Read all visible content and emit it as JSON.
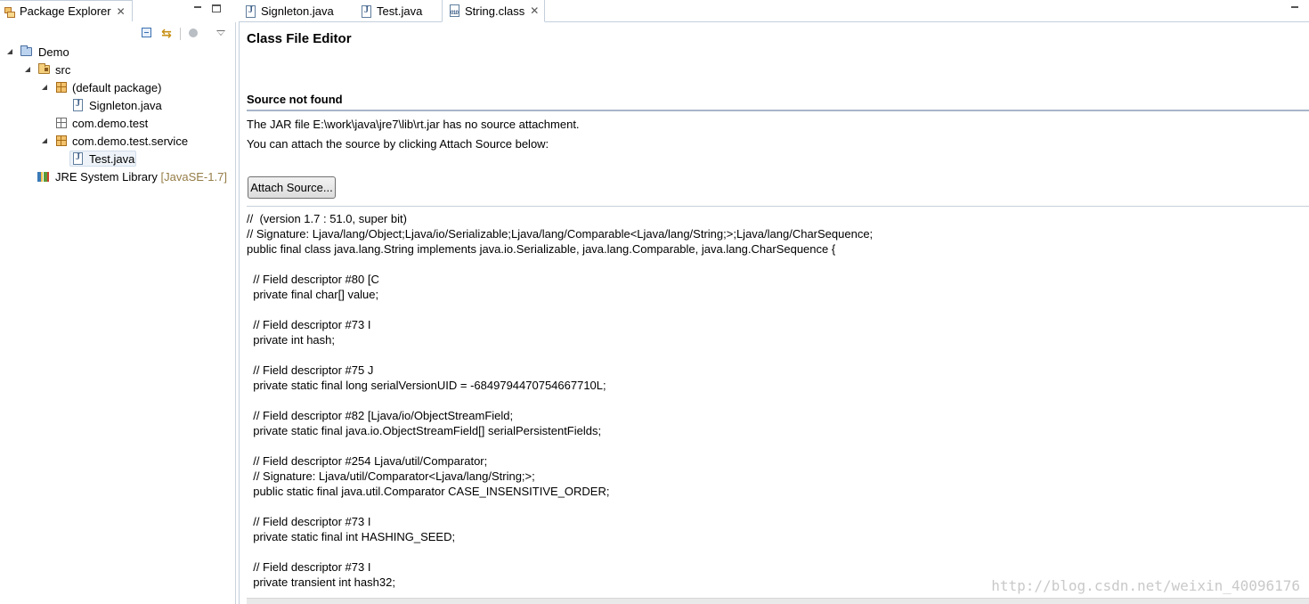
{
  "package_explorer": {
    "tab_label": "Package Explorer",
    "tree": [
      {
        "label": "Demo",
        "icon": "project-icon",
        "expanded": true
      },
      {
        "label": "src",
        "icon": "source-folder-icon",
        "expanded": true
      },
      {
        "label": "(default package)",
        "icon": "package-icon",
        "expanded": true
      },
      {
        "label": "Signleton.java",
        "icon": "java-file-icon",
        "expanded": false
      },
      {
        "label": "com.demo.test",
        "icon": "empty-package-icon"
      },
      {
        "label": "com.demo.test.service",
        "icon": "package-icon",
        "expanded": true
      },
      {
        "label": "Test.java",
        "icon": "java-file-icon",
        "expanded": false,
        "selected": true
      },
      {
        "label": "JRE System Library",
        "suffix": "[JavaSE-1.7]",
        "icon": "library-icon",
        "expanded": false
      }
    ]
  },
  "editor": {
    "tabs": [
      {
        "label": "Signleton.java",
        "icon": "java-file-icon",
        "active": false
      },
      {
        "label": "Test.java",
        "icon": "java-file-icon",
        "active": false
      },
      {
        "label": "String.class",
        "icon": "class-file-icon",
        "active": true
      }
    ],
    "title": "Class File Editor",
    "section_title": "Source not found",
    "message_line1": "The JAR file E:\\work\\java\\jre7\\lib\\rt.jar has no source attachment.",
    "message_line2": "You can attach the source by clicking Attach Source below:",
    "attach_button": "Attach Source...",
    "code_lines": [
      "//  (version 1.7 : 51.0, super bit)",
      "// Signature: Ljava/lang/Object;Ljava/io/Serializable;Ljava/lang/Comparable<Ljava/lang/String;>;Ljava/lang/CharSequence;",
      "public final class java.lang.String implements java.io.Serializable, java.lang.Comparable, java.lang.CharSequence {",
      "",
      "  // Field descriptor #80 [C",
      "  private final char[] value;",
      "",
      "  // Field descriptor #73 I",
      "  private int hash;",
      "",
      "  // Field descriptor #75 J",
      "  private static final long serialVersionUID = -6849794470754667710L;",
      "",
      "  // Field descriptor #82 [Ljava/io/ObjectStreamField;",
      "  private static final java.io.ObjectStreamField[] serialPersistentFields;",
      "",
      "  // Field descriptor #254 Ljava/util/Comparator;",
      "  // Signature: Ljava/util/Comparator<Ljava/lang/String;>;",
      "  public static final java.util.Comparator CASE_INSENSITIVE_ORDER;",
      "",
      "  // Field descriptor #73 I",
      "  private static final int HASHING_SEED;",
      "",
      "  // Field descriptor #73 I",
      "  private transient int hash32;"
    ]
  },
  "watermark": "http://blog.csdn.net/weixin_40096176",
  "colors": {
    "library_suffix": "#957d47",
    "rule": "#a8b6c9",
    "tab_border": "#c3cfdc"
  }
}
